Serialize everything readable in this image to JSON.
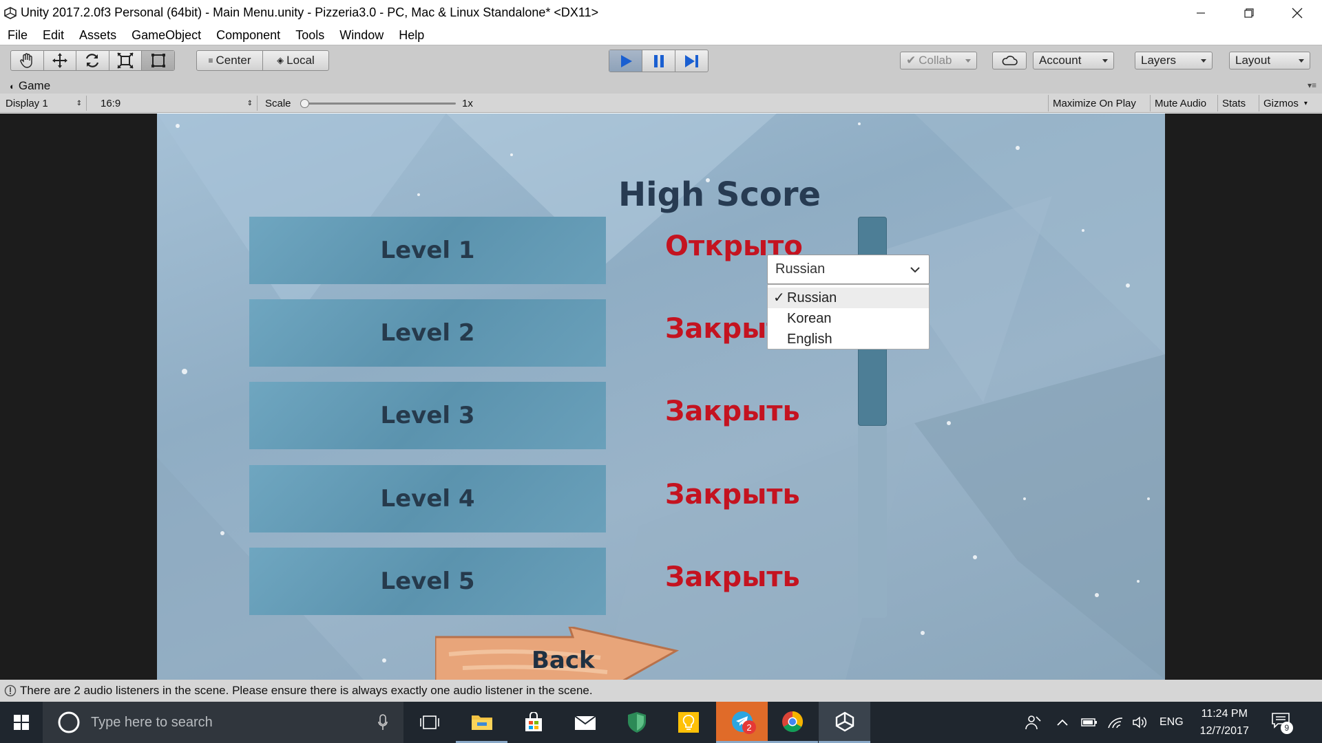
{
  "window": {
    "title": "Unity 2017.2.0f3 Personal (64bit) - Main Menu.unity - Pizzeria3.0 - PC, Mac & Linux Standalone* <DX11>"
  },
  "menu": [
    "File",
    "Edit",
    "Assets",
    "GameObject",
    "Component",
    "Tools",
    "Window",
    "Help"
  ],
  "toolbar": {
    "pivot_label": "Center",
    "space_label": "Local",
    "collab_label": "Collab",
    "account_label": "Account",
    "layers_label": "Layers",
    "layout_label": "Layout"
  },
  "game_panel": {
    "tab_label": "Game",
    "display_label": "Display 1",
    "aspect_label": "16:9",
    "scale_label": "Scale",
    "scale_value": "1x",
    "scale_fraction": 0.0,
    "maximize_label": "Maximize On Play",
    "mute_label": "Mute Audio",
    "stats_label": "Stats",
    "gizmos_label": "Gizmos"
  },
  "game": {
    "title": "High Score",
    "levels": [
      {
        "name": "Level 1",
        "status": "Открыто"
      },
      {
        "name": "Level 2",
        "status": "Закрыть"
      },
      {
        "name": "Level 3",
        "status": "Закрыть"
      },
      {
        "name": "Level 4",
        "status": "Закрыть"
      },
      {
        "name": "Level 5",
        "status": "Закрыть"
      }
    ],
    "language_dropdown": {
      "selected": "Russian",
      "options": [
        "Russian",
        "Korean",
        "English"
      ]
    },
    "back_label": "Back",
    "colors": {
      "status": "#c41320",
      "title": "#273b52"
    }
  },
  "console": {
    "message": "There are 2 audio listeners in the scene. Please ensure there is always exactly one audio listener in the scene."
  },
  "taskbar": {
    "search_placeholder": "Type here to search",
    "language": "ENG",
    "time": "11:24 PM",
    "date": "12/7/2017",
    "telegram_badge": "2",
    "notification_badge": "9"
  }
}
